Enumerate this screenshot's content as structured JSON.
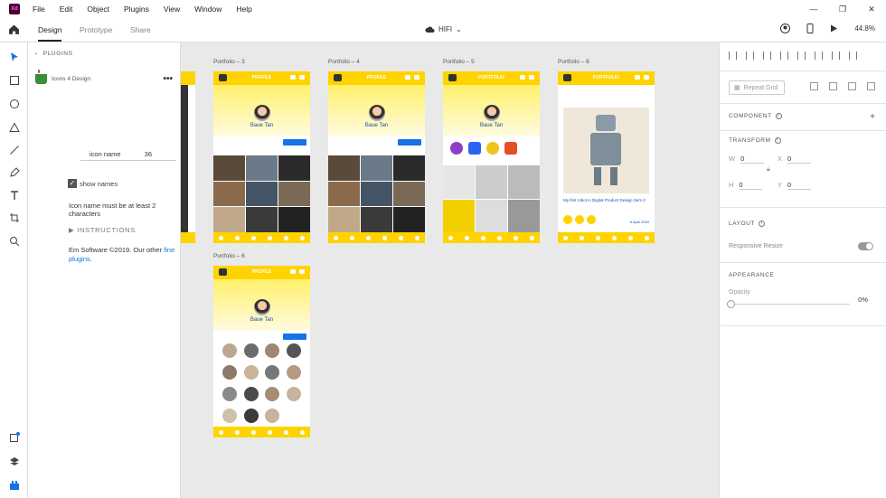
{
  "app": {
    "logo_text": "Xd",
    "menu": [
      "File",
      "Edit",
      "Object",
      "Plugins",
      "View",
      "Window",
      "Help"
    ]
  },
  "tabs": [
    "Design",
    "Prototype",
    "Share"
  ],
  "document": {
    "name": "HIFI",
    "zoom": "44.8%"
  },
  "plugin_panel": {
    "header": "PLUGINS",
    "plugin_name": "Icons 4 Design",
    "field_label": "icon name",
    "field_value": "36",
    "show_names_label": "show names",
    "show_names_checked": true,
    "error_text": "Icon name must be at least 2 characters",
    "instructions_label": "INSTRUCTIONS",
    "copyright_text": "Em Software ©2019. Our other ",
    "copyright_link": "fine plugins",
    "copyright_end": "."
  },
  "artboards": [
    {
      "label": "Portfolio – 3",
      "title": "PROFILE",
      "name": "Baue Tan"
    },
    {
      "label": "Portfolio – 4",
      "title": "PROFILE",
      "name": "Baue Tan"
    },
    {
      "label": "Portfolio – 5",
      "title": "PORTFOLIO",
      "name": "Baue Tan"
    },
    {
      "label": "Portfolio – 8",
      "title": "PORTFOLIO",
      "caption": "My first robot in Digital Product Design Sem 2",
      "date": "9 April 2020"
    },
    {
      "label": "Portfolio – 6",
      "title": "PROFILE",
      "name": "Baue Tan"
    }
  ],
  "right_panel": {
    "repeat_grid_label": "Repeat Grid",
    "component_header": "COMPONENT",
    "transform_header": "TRANSFORM",
    "transform": {
      "W": "0",
      "X": "0",
      "H": "0",
      "Y": "0"
    },
    "layout_header": "LAYOUT",
    "responsive_resize_label": "Responsive Resize",
    "appearance_header": "APPEARANCE",
    "opacity_label": "Opacity",
    "opacity_value": "0%"
  },
  "colors": {
    "accent": "#ffd300",
    "brand": "#470137",
    "link": "#1473e6"
  }
}
